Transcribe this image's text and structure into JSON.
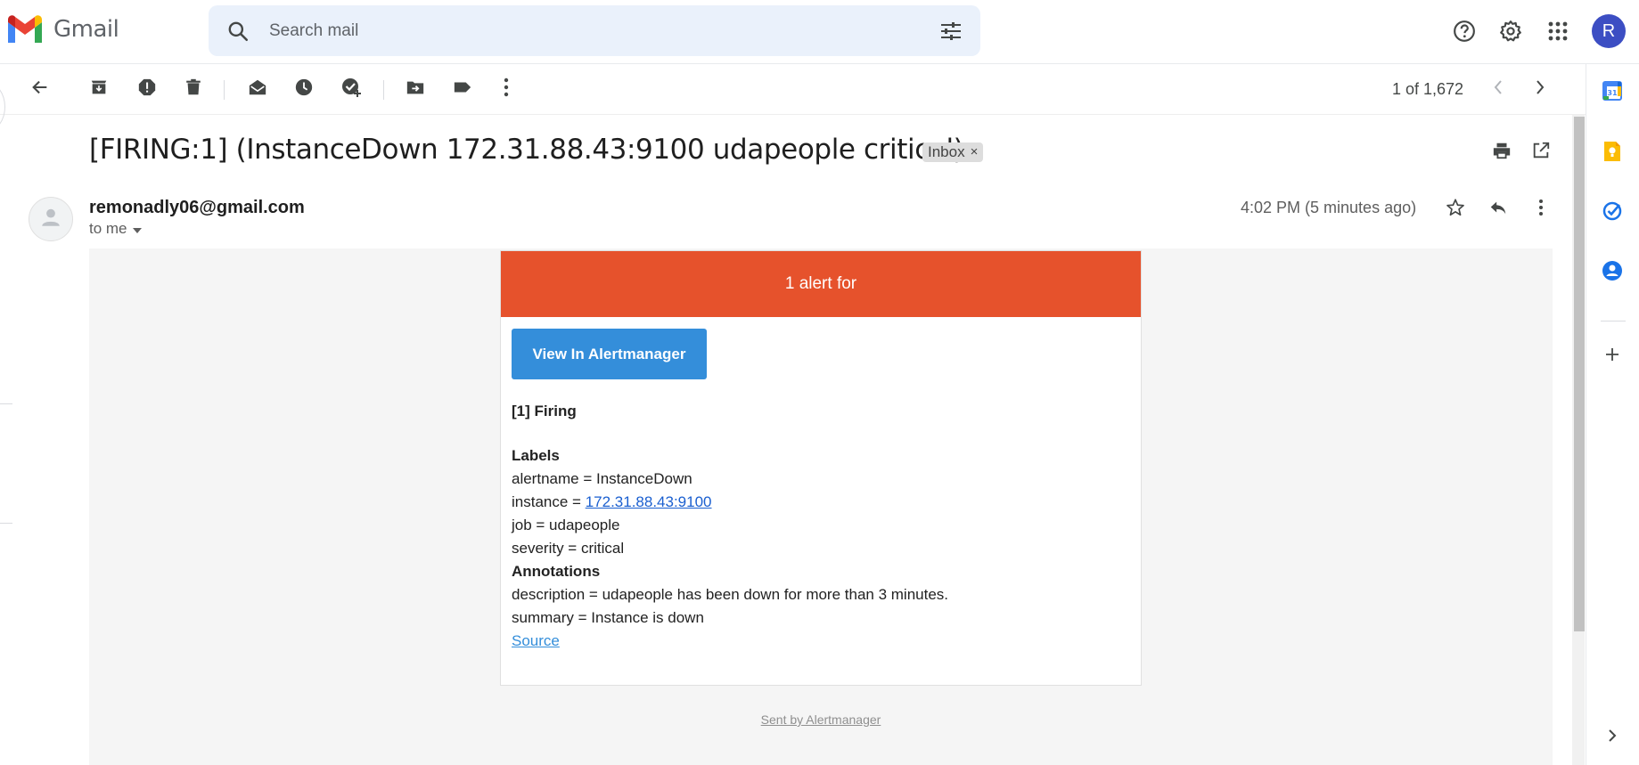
{
  "app": {
    "name": "Gmail"
  },
  "search": {
    "placeholder": "Search mail"
  },
  "account": {
    "initial": "R",
    "color": "#3c4ec3"
  },
  "pager": {
    "text": "1 of 1,672"
  },
  "message": {
    "subject": "[FIRING:1] (InstanceDown 172.31.88.43:9100 udapeople critical)",
    "label": "Inbox",
    "label_remove": "×",
    "sender": "remonadly06@gmail.com",
    "recipient": "to me",
    "time": "4:02 PM (5 minutes ago)"
  },
  "email": {
    "banner": "1 alert for",
    "banner_color": "#e6522c",
    "button": "View In Alertmanager",
    "button_color": "#348eda",
    "firing_heading": "[1] Firing",
    "labels_heading": "Labels",
    "alertname": "alertname = InstanceDown",
    "instance_prefix": "instance = ",
    "instance_value": "172.31.88.43:9100",
    "job": "job = udapeople",
    "severity": "severity = critical",
    "annotations_heading": "Annotations",
    "description": "description = udapeople has been down for more than 3 minutes.",
    "summary": "summary = Instance is down",
    "source_link": "Source",
    "footer": "Sent by Alertmanager"
  },
  "icons": {
    "toolbar": [
      "back-icon",
      "archive-icon",
      "report-spam-icon",
      "delete-icon",
      "mark-unread-icon",
      "snooze-icon",
      "add-to-tasks-icon",
      "move-to-icon",
      "labels-icon",
      "more-vert-icon"
    ],
    "top_right": [
      "help-icon",
      "settings-icon",
      "apps-icon"
    ],
    "side_panel": [
      "calendar-icon",
      "keep-icon",
      "tasks-icon",
      "contacts-icon",
      "add-icon",
      "expand-icon"
    ]
  }
}
